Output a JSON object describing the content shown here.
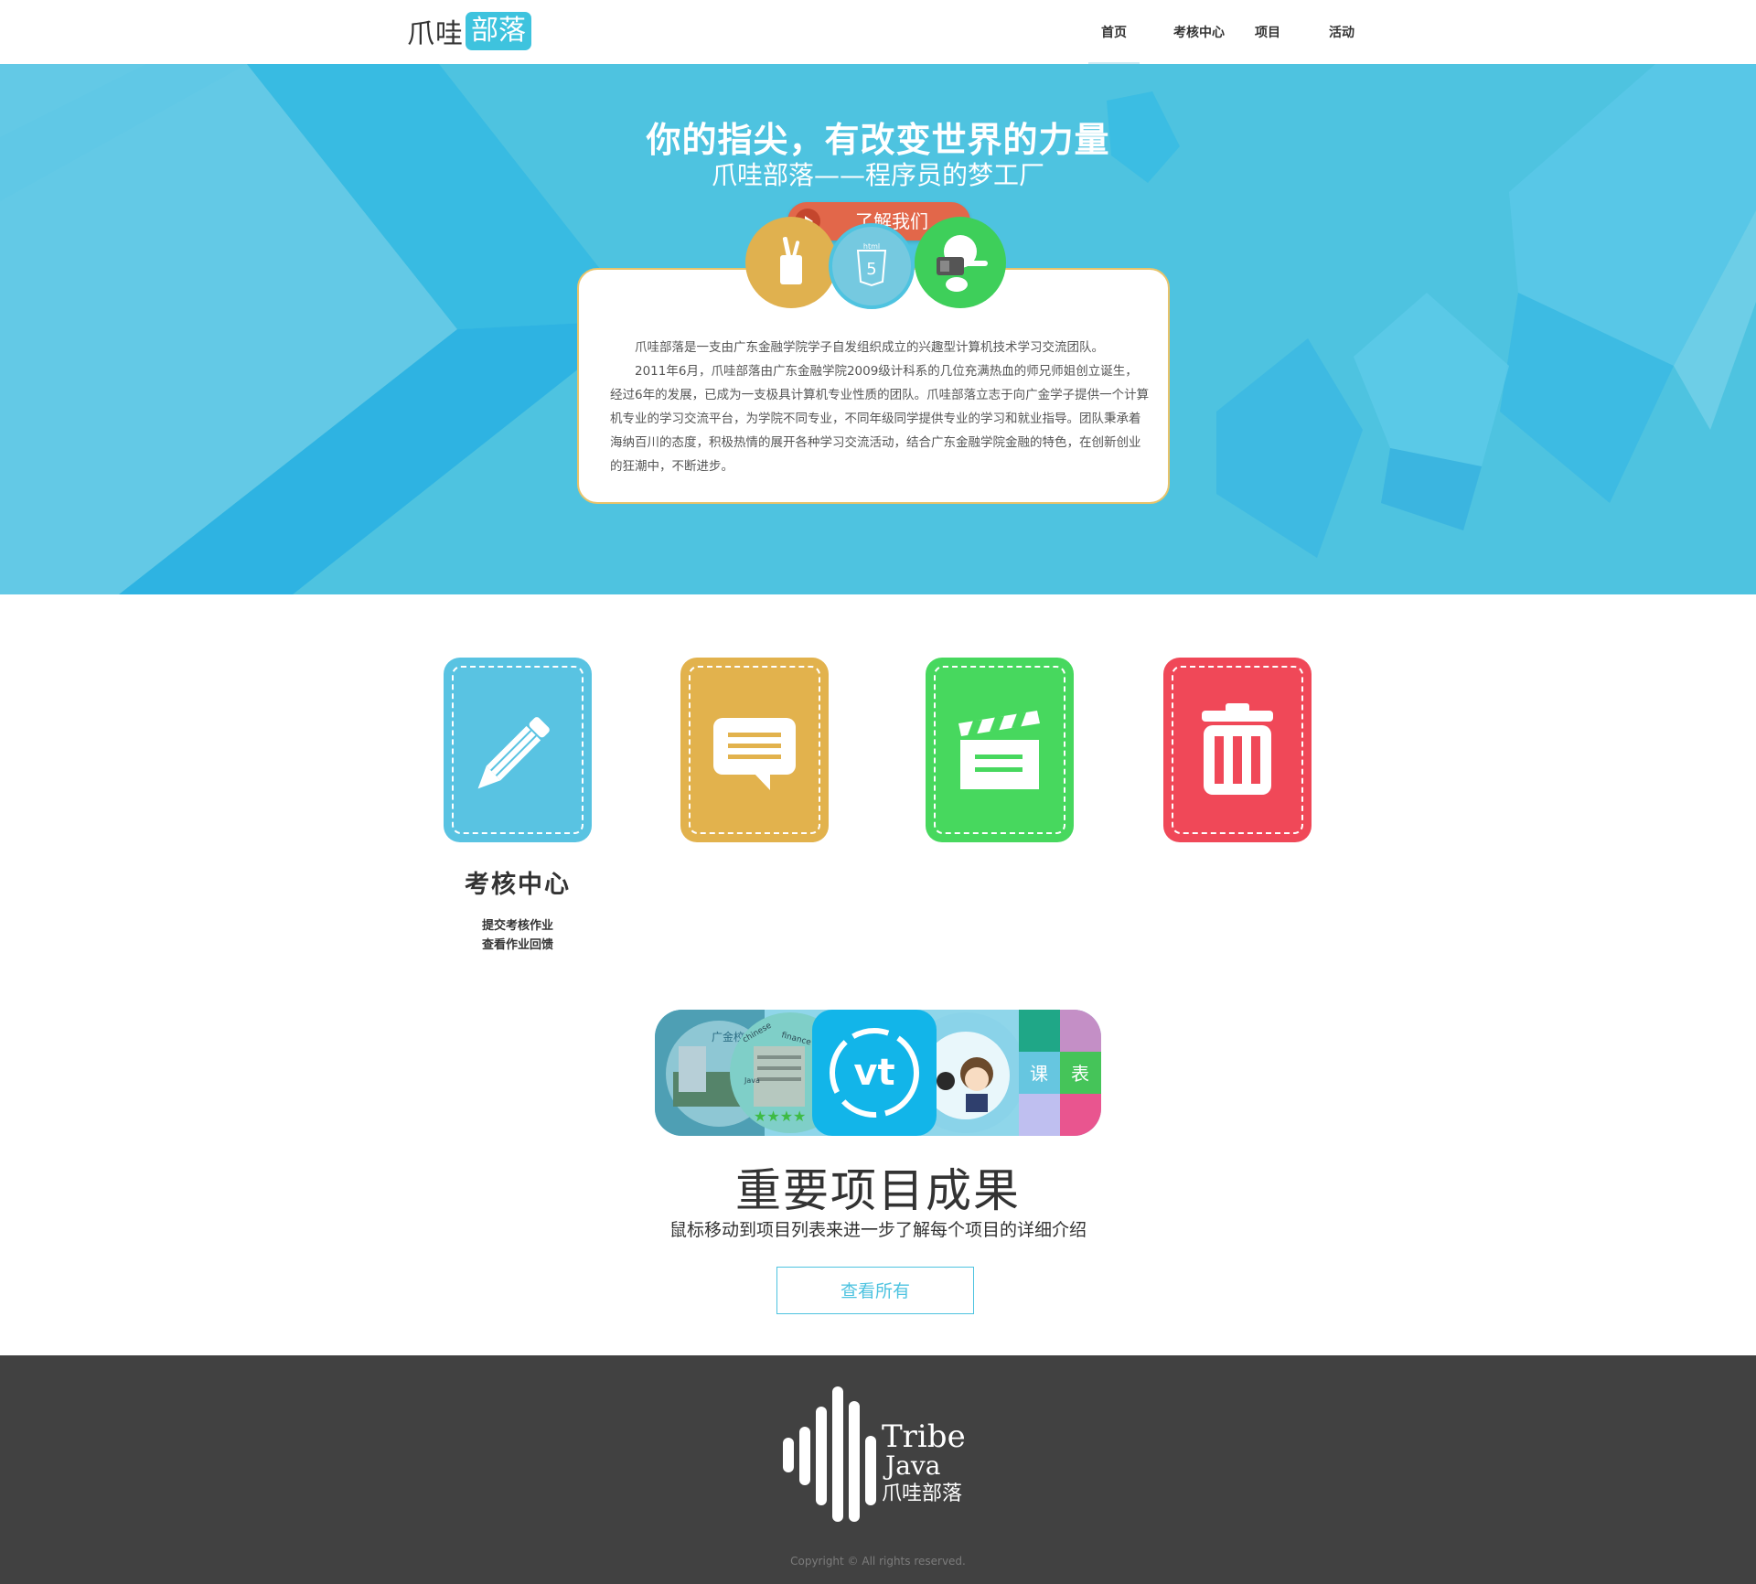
{
  "header": {
    "logo": {
      "part1": "爪哇",
      "part2": "部落"
    },
    "nav": [
      {
        "label": "首页",
        "active": true
      },
      {
        "label": "考核中心",
        "active": false
      },
      {
        "label": "项目",
        "active": false
      },
      {
        "label": "活动",
        "active": false
      }
    ]
  },
  "hero": {
    "title": "你的指尖，有改变世界的力量",
    "subtitle": "爪哇部落——程序员的梦工厂",
    "button_label": "了解我们",
    "badges": {
      "html_icon_text": "html",
      "html_icon_number": "5"
    },
    "card_paragraphs": [
      "爪哇部落是一支由广东金融学院学子自发组织成立的兴趣型计算机技术学习交流团队。",
      "2011年6月，爪哇部落由广东金融学院2009级计科系的几位充满热血的师兄师姐创立诞生，经过6年的发展，已成为一支极具计算机专业性质的团队。爪哇部落立志于向广金学子提供一个计算机专业的学习交流平台，为学院不同专业，不同年级同学提供专业的学习和就业指导。团队秉承着海纳百川的态度，积极热情的展开各种学习交流活动，结合广东金融学院金融的特色，在创新创业的狂潮中，不断进步。"
    ]
  },
  "features": {
    "items": [
      {
        "icon": "pencil-icon",
        "color": "#59c3e2"
      },
      {
        "icon": "chat-bubble-icon",
        "color": "#e2b24d"
      },
      {
        "icon": "clapperboard-icon",
        "color": "#47d85e"
      },
      {
        "icon": "trash-icon",
        "color": "#f04858"
      }
    ],
    "active_title": "考核中心",
    "active_links": [
      "提交考核作业",
      "查看作业回馈"
    ]
  },
  "projects": {
    "thumb_texts": {
      "t1": "广金校",
      "t2_a": "chinese",
      "t2_b": "finance",
      "t2_c": "Java",
      "t3": "vt",
      "t5_a": "课",
      "t5_b": "表"
    },
    "title": "重要项目成果",
    "subtitle": "鼠标移动到项目列表来进一步了解每个项目的详细介绍",
    "button_label": "查看所有"
  },
  "footer": {
    "logo": {
      "line1": "Tribe",
      "line2": "Java",
      "line3": "爪哇部落"
    },
    "copyright": "Copyright © All rights reserved."
  },
  "colors": {
    "primary": "#4ec3e0",
    "accent_orange": "#e2674a",
    "footer_bg": "#414141"
  }
}
